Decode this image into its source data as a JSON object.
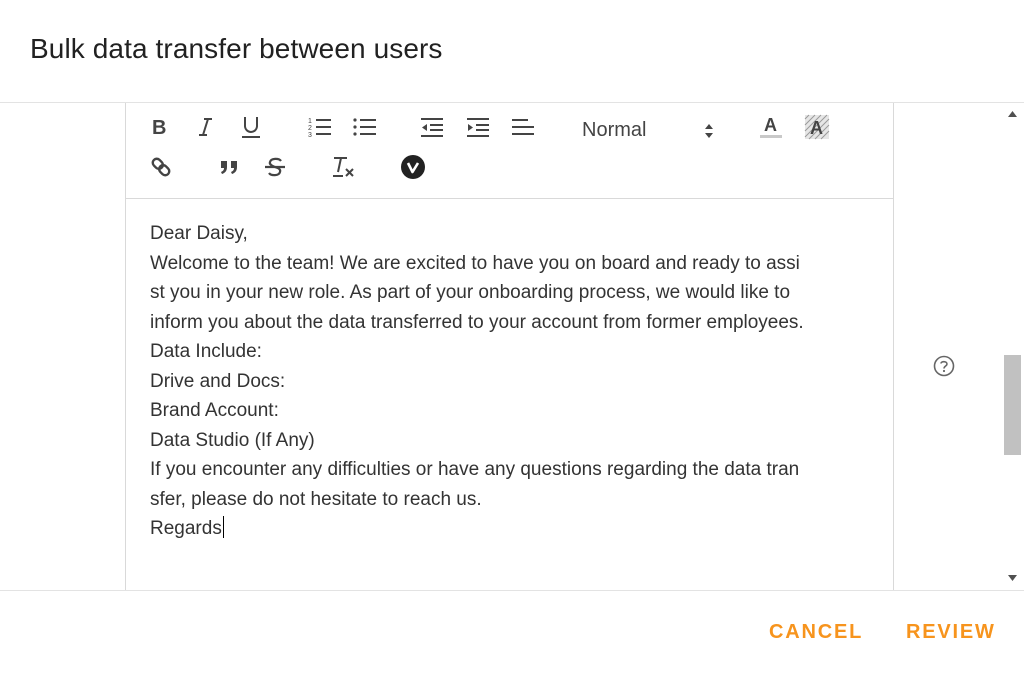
{
  "dialog": {
    "title": "Bulk data transfer between users"
  },
  "toolbar": {
    "buttons": [
      {
        "name": "bold-button",
        "icon": "bold-icon"
      },
      {
        "name": "italic-button",
        "icon": "italic-icon"
      },
      {
        "name": "underline-button",
        "icon": "underline-icon"
      },
      {
        "name": "ordered-list-button",
        "icon": "ordered-list-icon"
      },
      {
        "name": "bullet-list-button",
        "icon": "bullet-list-icon"
      },
      {
        "name": "outdent-button",
        "icon": "outdent-icon"
      },
      {
        "name": "indent-button",
        "icon": "indent-icon"
      },
      {
        "name": "align-button",
        "icon": "align-left-icon"
      },
      {
        "name": "text-color-button",
        "icon": "text-color-icon"
      },
      {
        "name": "background-color-button",
        "icon": "background-color-icon"
      },
      {
        "name": "link-button",
        "icon": "link-icon"
      },
      {
        "name": "blockquote-button",
        "icon": "quote-icon"
      },
      {
        "name": "strikethrough-button",
        "icon": "strikethrough-icon"
      },
      {
        "name": "clear-format-button",
        "icon": "clear-format-icon"
      },
      {
        "name": "video-button",
        "icon": "video-icon"
      }
    ],
    "size_select": {
      "value": "Normal"
    }
  },
  "editor": {
    "lines": [
      "Dear Daisy,",
      "Welcome to the team! We are excited to have you on board and ready to assi",
      "st you in your new role. As part of your onboarding process, we would like to",
      "inform you about the data transferred to your account from former employees.",
      "Data Include:",
      "Drive and Docs:",
      "Brand Account:",
      "Data Studio (If Any)",
      "If you encounter any difficulties or have any questions regarding the data tran",
      "sfer, please do not hesitate to reach us.",
      "Regards"
    ]
  },
  "actions": {
    "cancel_label": "CANCEL",
    "review_label": "REVIEW"
  },
  "colors": {
    "accent": "#f7941d",
    "divider": "#e3e3e3",
    "scroll_thumb": "#c1c1c1"
  }
}
